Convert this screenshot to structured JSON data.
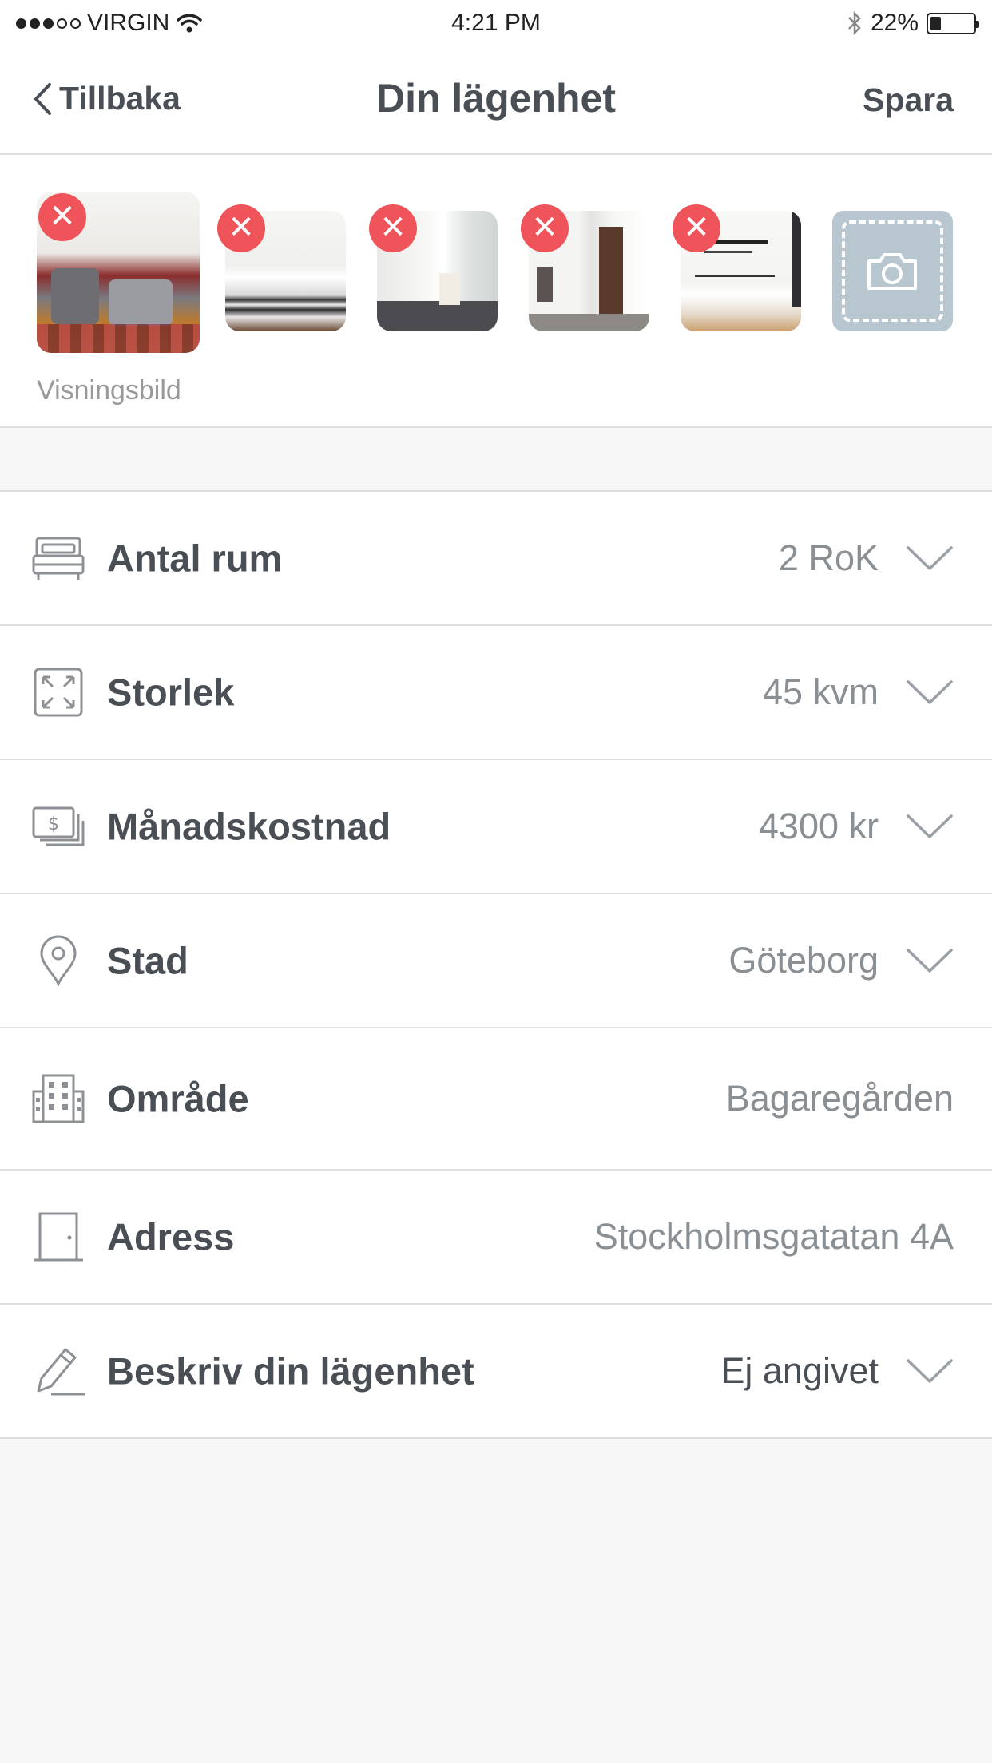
{
  "status_bar": {
    "carrier": "VIRGIN",
    "time": "4:21 PM",
    "battery": "22%",
    "battery_level": 0.22,
    "icons": [
      "signal-dots",
      "wifi-icon",
      "bluetooth-icon",
      "battery-icon"
    ]
  },
  "nav": {
    "back_label": "Tillbaka",
    "title": "Din lägenhet",
    "save_label": "Spara"
  },
  "photos": {
    "display_label": "Visningsbild",
    "delete_symbol": "✕",
    "add_icon": "camera-icon"
  },
  "rows": [
    {
      "label": "Antal rum",
      "value": "2 RoK",
      "icon": "bed-icon",
      "dropdown": true
    },
    {
      "label": "Storlek",
      "value": "45 kvm",
      "icon": "expand-icon",
      "dropdown": true
    },
    {
      "label": "Månadskostnad",
      "value": "4300 kr",
      "icon": "money-icon",
      "dropdown": true
    },
    {
      "label": "Stad",
      "value": "Göteborg",
      "icon": "location-pin-icon",
      "dropdown": true
    },
    {
      "label": "Område",
      "value": "Bagaregården",
      "icon": "building-icon",
      "dropdown": false
    },
    {
      "label": "Adress",
      "value": "Stockholmsgatatan 4A",
      "icon": "door-icon",
      "dropdown": false
    },
    {
      "label": "Beskriv din lägenhet",
      "value": "Ej angivet",
      "icon": "pencil-icon",
      "dropdown": true
    }
  ],
  "colors": {
    "accent_delete": "#f0545b",
    "add_photo_bg": "#b7c6cf",
    "text_primary": "#4a4f55",
    "text_secondary": "#8a8f94"
  }
}
